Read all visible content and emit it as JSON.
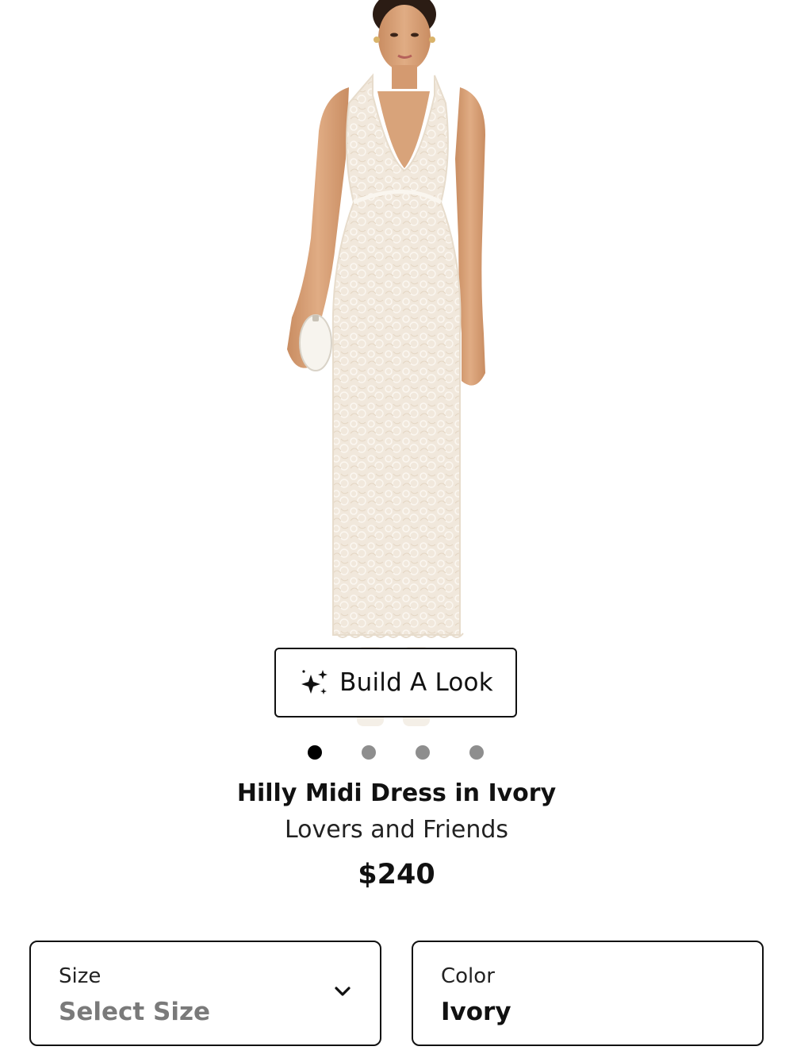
{
  "product": {
    "build_look_label": "Build A Look",
    "title": "Hilly Midi Dress in Ivory",
    "brand": "Lovers and Friends",
    "price": "$240"
  },
  "gallery": {
    "image_count": 4,
    "active_index": 0
  },
  "selectors": {
    "size": {
      "label": "Size",
      "value": "Select Size"
    },
    "color": {
      "label": "Color",
      "value": "Ivory"
    }
  },
  "icons": {
    "build_look": "sparkles-icon",
    "size_dropdown": "chevron-down-icon"
  },
  "colors": {
    "text": "#111111",
    "dot_active": "#000000",
    "dot_inactive": "#8e8e8e",
    "placeholder": "#7a7a7a",
    "dress": "#f3ece2",
    "skin": "#d8a37a"
  }
}
